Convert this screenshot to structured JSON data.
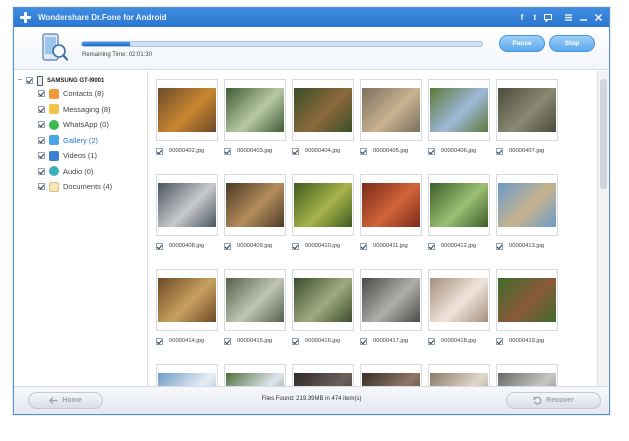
{
  "window": {
    "title": "Wondershare Dr.Fone for Android"
  },
  "titlebar": {
    "social_icons": [
      "facebook-icon",
      "twitter-icon",
      "feedback-icon"
    ],
    "window_icons": [
      "menu-icon",
      "minimize-icon",
      "close-icon"
    ]
  },
  "progress": {
    "fraction": 0.12,
    "remaining_label": "Remaining Time:",
    "remaining_value": "02:01:30",
    "pause_label": "Pause",
    "stop_label": "Stop"
  },
  "device": {
    "name": "SAMSUNG GT-I9001"
  },
  "categories": [
    {
      "label": "Contacts (8)",
      "icon": "contacts-icon"
    },
    {
      "label": "Messaging (8)",
      "icon": "messaging-icon"
    },
    {
      "label": "WhatsApp (0)",
      "icon": "whatsapp-icon"
    },
    {
      "label": "Gallery (2)",
      "icon": "gallery-icon",
      "active": true
    },
    {
      "label": "Videos (1)",
      "icon": "videos-icon"
    },
    {
      "label": "Audio (0)",
      "icon": "audio-icon"
    },
    {
      "label": "Documents (4)",
      "icon": "documents-icon"
    }
  ],
  "gallery": [
    {
      "file": "00000402.jpg",
      "colors": [
        "#6b4a2a",
        "#c9862f"
      ]
    },
    {
      "file": "00000403.jpg",
      "colors": [
        "#3f5a35",
        "#b7c9a4"
      ]
    },
    {
      "file": "00000404.jpg",
      "colors": [
        "#3a4f26",
        "#8c6a3d"
      ]
    },
    {
      "file": "00000405.jpg",
      "colors": [
        "#7c6f5f",
        "#c9b28f"
      ]
    },
    {
      "file": "00000406.jpg",
      "colors": [
        "#5d7a3a",
        "#9fb8d8"
      ]
    },
    {
      "file": "00000407.jpg",
      "colors": [
        "#4c4a3b",
        "#8a8a73"
      ]
    },
    {
      "file": "00000408.jpg",
      "colors": [
        "#4b5560",
        "#c7c9cc"
      ]
    },
    {
      "file": "00000409.jpg",
      "colors": [
        "#4b3a26",
        "#b58d5c"
      ]
    },
    {
      "file": "00000410.jpg",
      "colors": [
        "#3e5a1f",
        "#a8b44a"
      ]
    },
    {
      "file": "00000411.jpg",
      "colors": [
        "#7a2a1a",
        "#d2643a"
      ]
    },
    {
      "file": "00000412.jpg",
      "colors": [
        "#3d5e2a",
        "#9bbf72"
      ]
    },
    {
      "file": "00000413.jpg",
      "colors": [
        "#6a9bc9",
        "#c8b38d"
      ]
    },
    {
      "file": "00000414.jpg",
      "colors": [
        "#6d4a24",
        "#c7a060"
      ]
    },
    {
      "file": "00000415.jpg",
      "colors": [
        "#55604a",
        "#c0c6b3"
      ]
    },
    {
      "file": "00000416.jpg",
      "colors": [
        "#3b4d2a",
        "#a0aa80"
      ]
    },
    {
      "file": "00000417.jpg",
      "colors": [
        "#4a4a48",
        "#b0aea8"
      ]
    },
    {
      "file": "00000418.jpg",
      "colors": [
        "#a58f7c",
        "#efe4dc"
      ]
    },
    {
      "file": "00000419.jpg",
      "colors": [
        "#3f6a2c",
        "#8a5a3a"
      ]
    },
    {
      "file": "",
      "colors": [
        "#6f9cc6",
        "#e8eef5"
      ]
    },
    {
      "file": "",
      "colors": [
        "#50703c",
        "#e0e6ee"
      ]
    },
    {
      "file": "",
      "colors": [
        "#2f2a28",
        "#6a605c"
      ]
    },
    {
      "file": "",
      "colors": [
        "#3a2e26",
        "#907868"
      ]
    },
    {
      "file": "",
      "colors": [
        "#8a7a66",
        "#e2d8cc"
      ]
    },
    {
      "file": "",
      "colors": [
        "#6a6a66",
        "#c6c6c2"
      ]
    }
  ],
  "footer": {
    "home_label": "Home",
    "found_text": "Files Found: 219.39MB in 474 item(s)",
    "recover_label": "Recover"
  }
}
